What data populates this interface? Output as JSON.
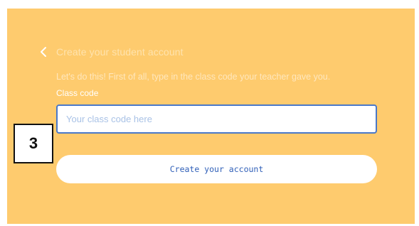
{
  "header": {
    "back_icon": "chevron-left-icon",
    "title": "Create your student account"
  },
  "intro_text": "Let's do this! First of all, type in the class code your teacher gave you.",
  "class_code": {
    "label": "Class code",
    "value": "",
    "placeholder": "Your class code here"
  },
  "create_button_label": "Create your account",
  "step_badge": "3",
  "colors": {
    "panel_background": "#fecb6e",
    "input_border": "#4a78c8",
    "button_text": "#2f5fb8"
  }
}
